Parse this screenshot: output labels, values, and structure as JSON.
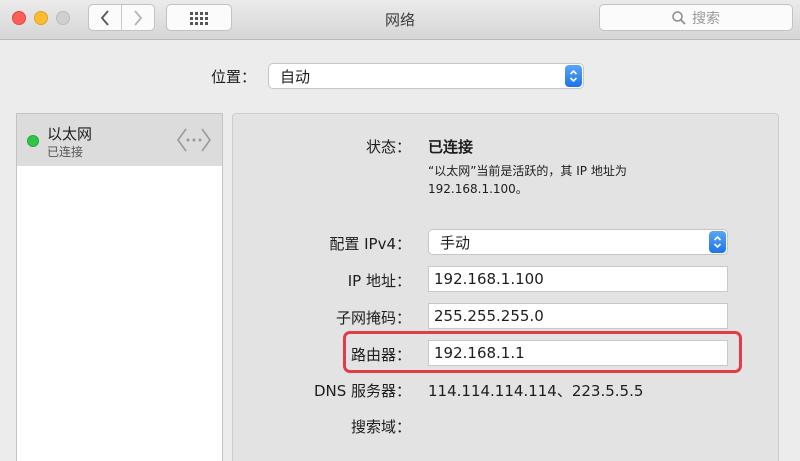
{
  "window": {
    "title": "网络"
  },
  "toolbar": {
    "search_placeholder": "搜索"
  },
  "location": {
    "label": "位置：",
    "value": "自动"
  },
  "sidebar": {
    "items": [
      {
        "name": "以太网",
        "status": "已连接",
        "status_color": "#2fc548"
      }
    ]
  },
  "details": {
    "status_label": "状态：",
    "status_value": "已连接",
    "status_desc_line1": "“以太网”当前是活跃的，其 IP 地址为",
    "status_desc_line2": "192.168.1.100。",
    "config_label": "配置 IPv4：",
    "config_value": "手动",
    "ip_label": "IP 地址：",
    "ip_value": "192.168.1.100",
    "subnet_label": "子网掩码：",
    "subnet_value": "255.255.255.0",
    "router_label": "路由器：",
    "router_value": "192.168.1.1",
    "dns_label": "DNS 服务器：",
    "dns_value": "114.114.114.114、223.5.5.5",
    "search_domain_label": "搜索域："
  },
  "colors": {
    "accent": "#1d74e8",
    "highlight": "#e33b47",
    "connected": "#2fc548"
  }
}
